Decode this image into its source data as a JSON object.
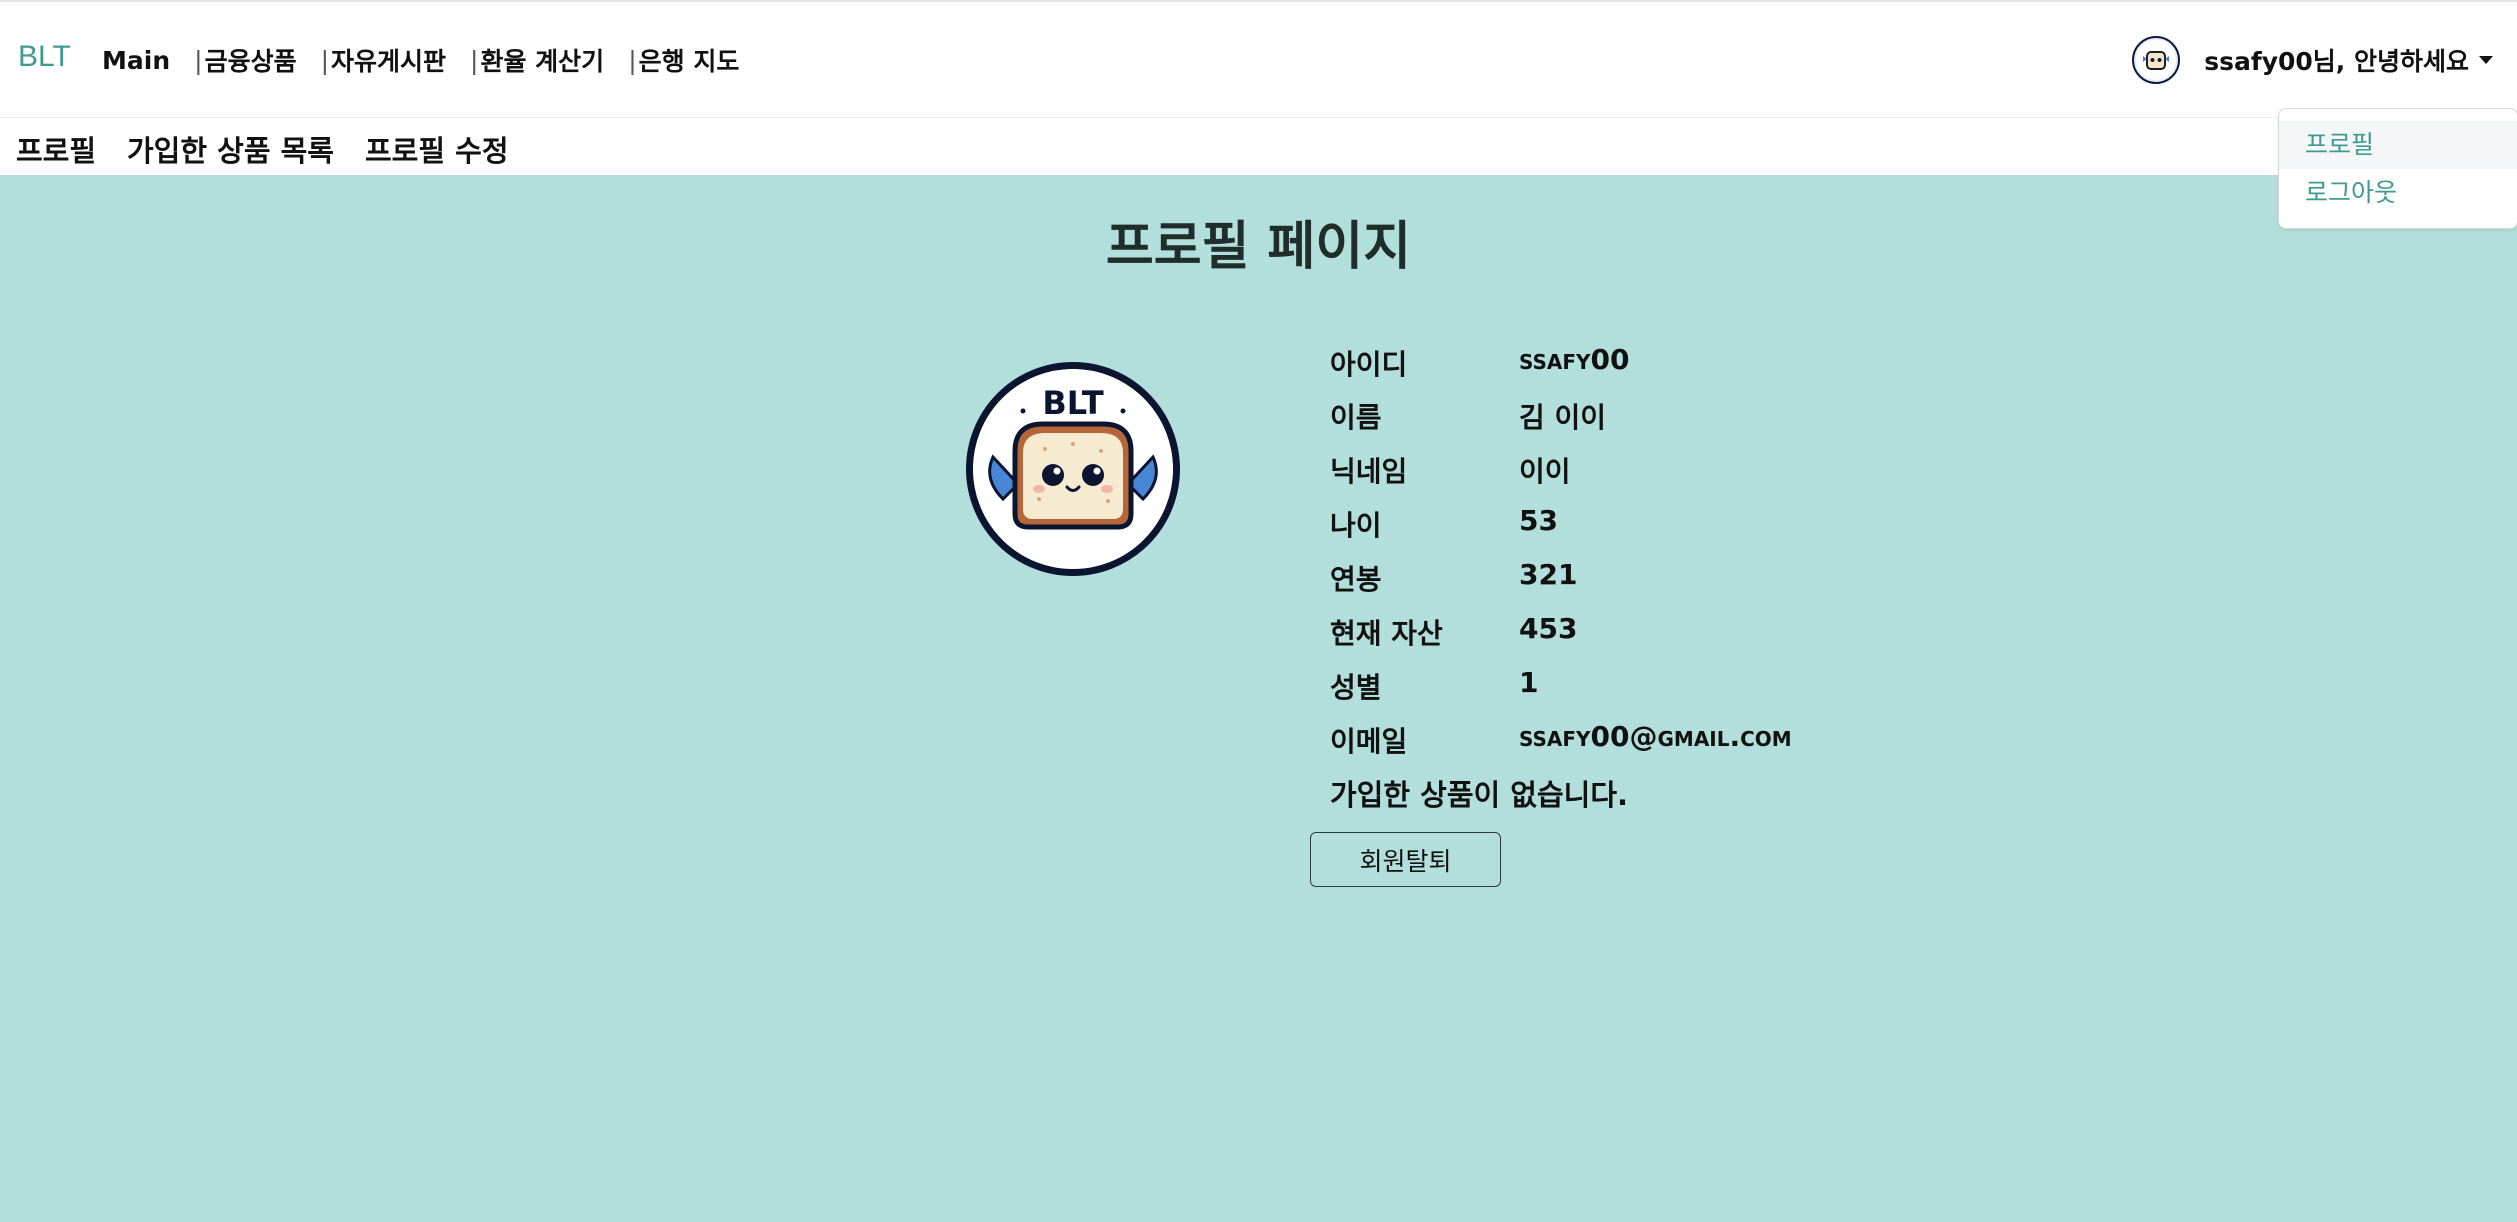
{
  "header": {
    "brand": "BLT",
    "nav": [
      {
        "label": "Main"
      },
      {
        "label": "금융상품"
      },
      {
        "label": "자유게시판"
      },
      {
        "label": "환율 계산기"
      },
      {
        "label": "은행 지도"
      }
    ],
    "nav_separator": "|",
    "greeting": "ssafy00님, 안녕하세요"
  },
  "dropdown": {
    "items": [
      {
        "label": "프로필"
      },
      {
        "label": "로그아웃"
      }
    ]
  },
  "subnav": {
    "items": [
      {
        "label": "프로필"
      },
      {
        "label": "가입한 상품 목록"
      },
      {
        "label": "프로필 수정"
      }
    ]
  },
  "main": {
    "title": "프로필 페이지",
    "profile_logo_text": "BLT",
    "fields": [
      {
        "label": "아이디",
        "value": "ssafy00"
      },
      {
        "label": "이름",
        "value": "김 이이"
      },
      {
        "label": "닉네임",
        "value": "이이"
      },
      {
        "label": "나이",
        "value": "53"
      },
      {
        "label": "연봉",
        "value": "321"
      },
      {
        "label": "현재 자산",
        "value": "453"
      },
      {
        "label": "성별",
        "value": "1"
      },
      {
        "label": "이메일",
        "value": "ssafy00@gmail.com"
      }
    ],
    "no_products": "가입한 상품이 없습니다.",
    "withdraw_label": "회원탈퇴"
  },
  "colors": {
    "background": "#b2dfdb",
    "accent": "#3f9a8f",
    "avatar_border": "#0b1530"
  }
}
